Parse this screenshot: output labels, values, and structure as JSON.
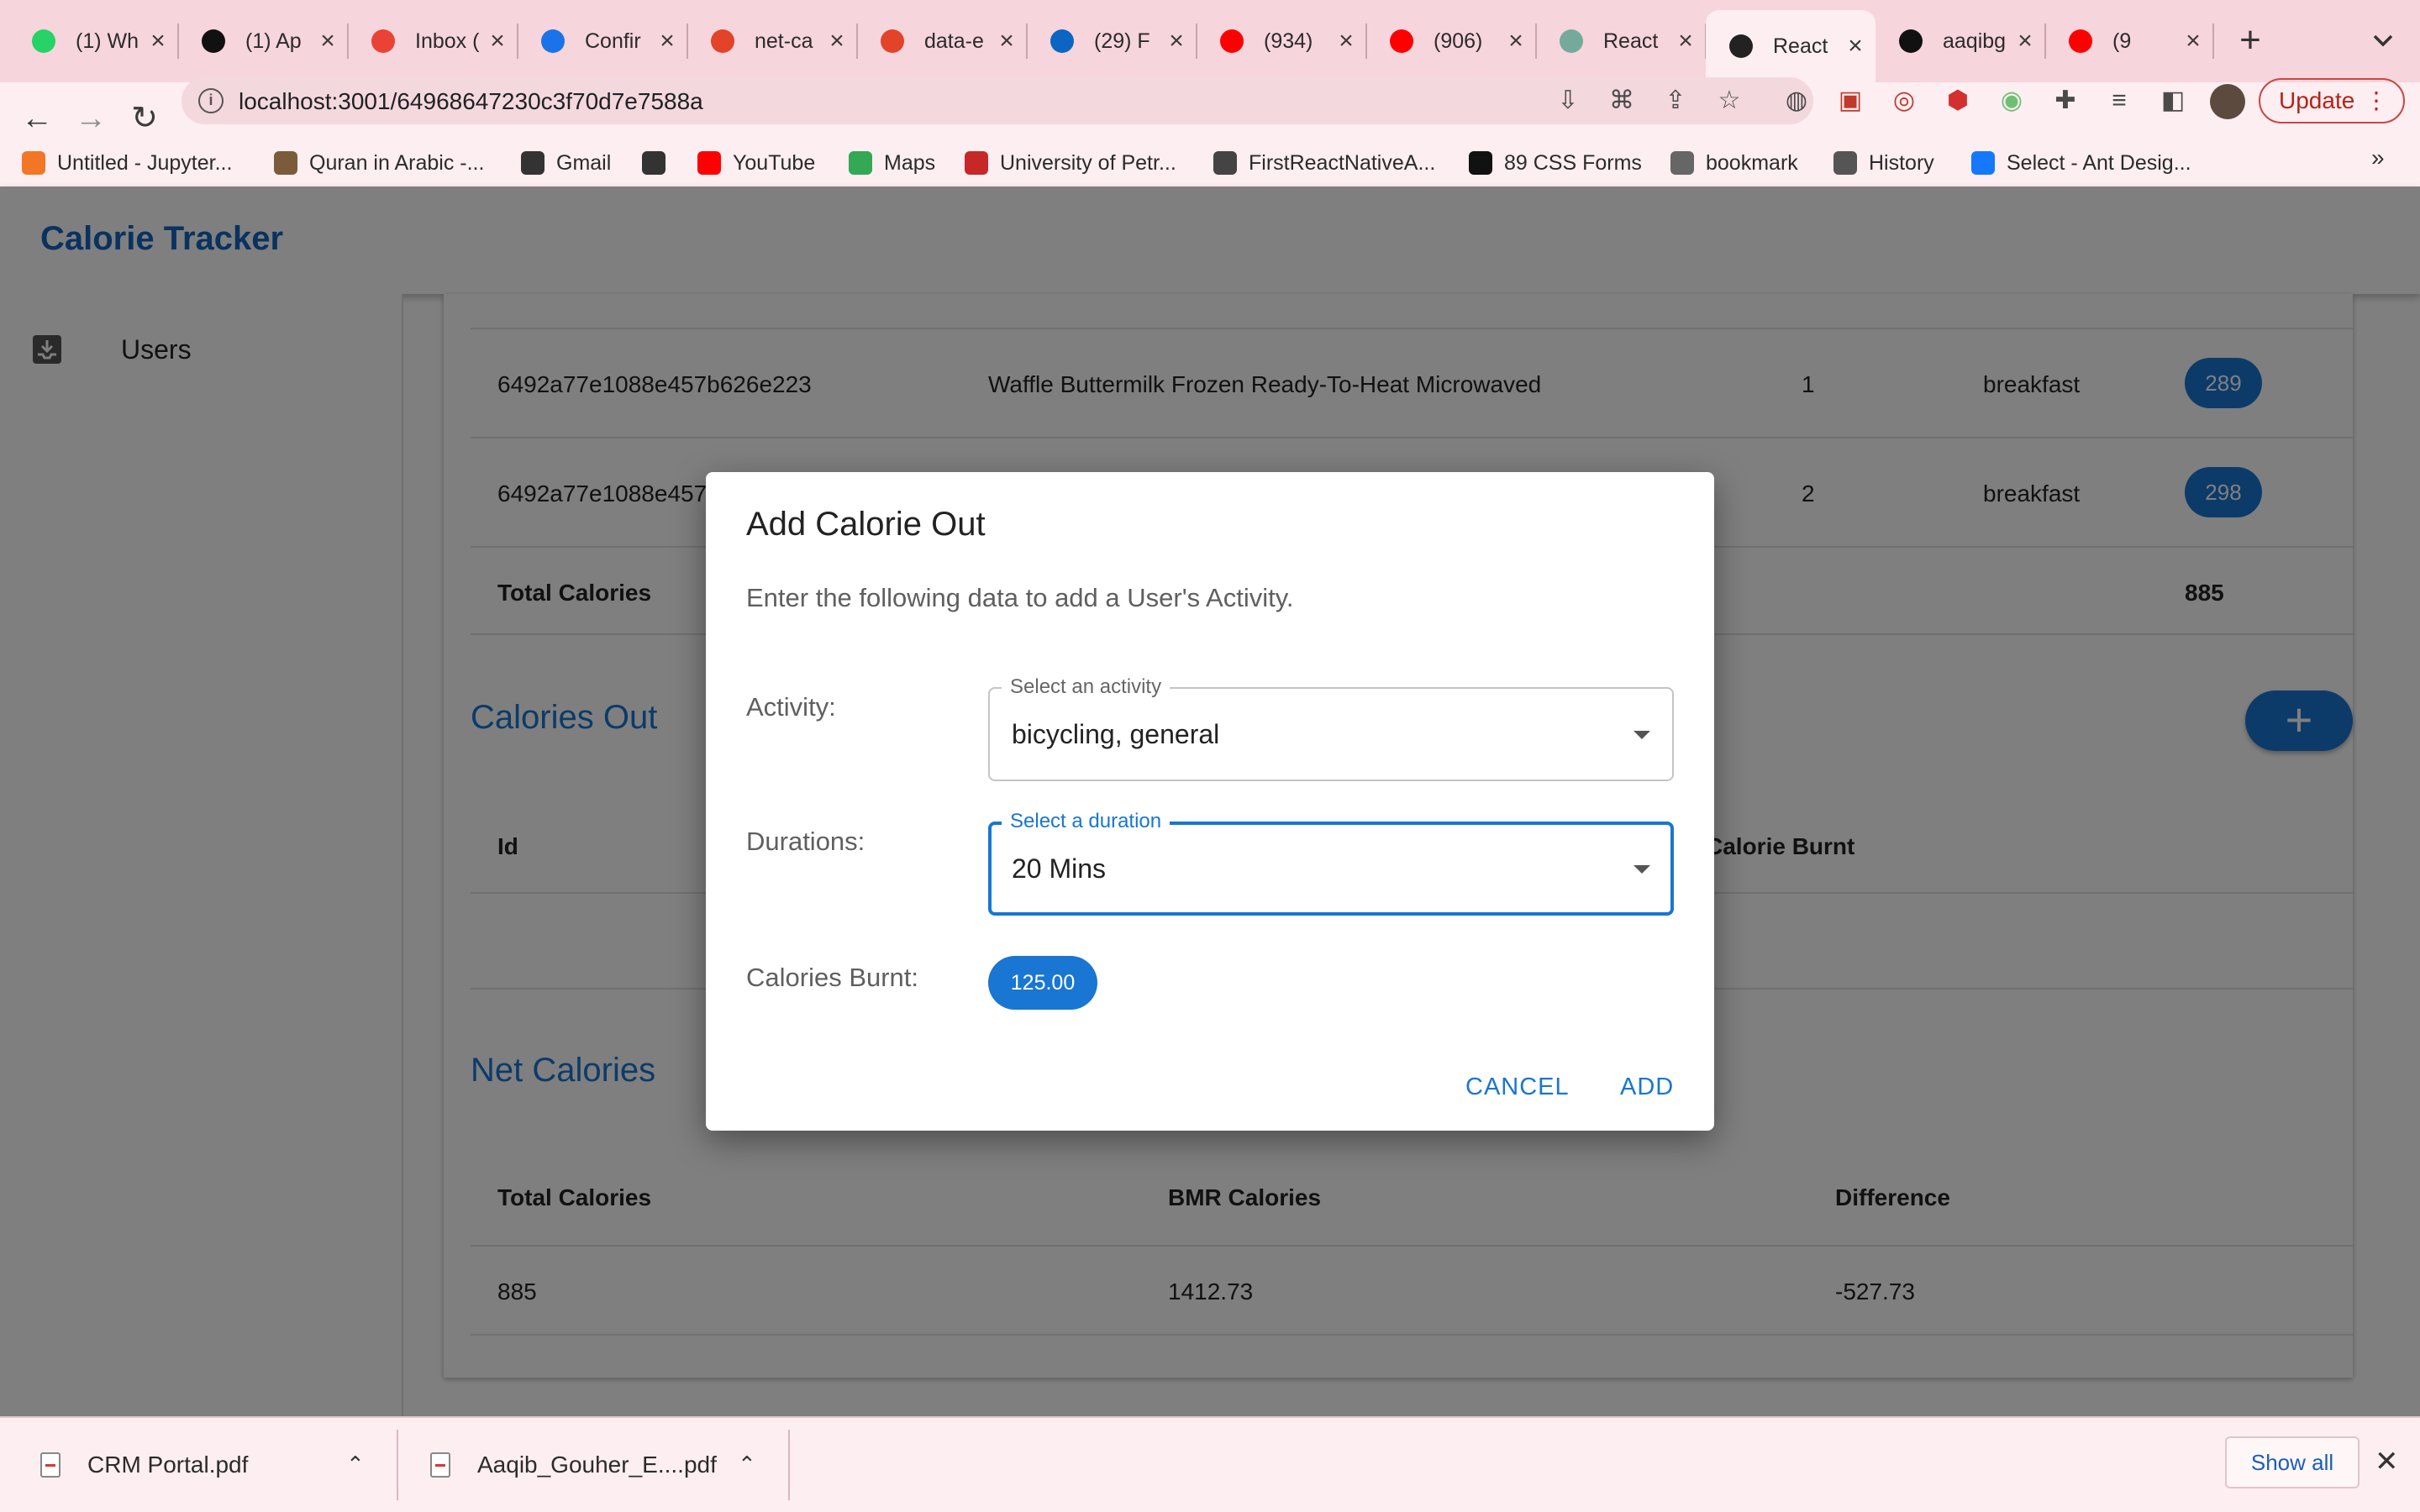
{
  "browser": {
    "tabs": [
      {
        "title": "(1) Wh",
        "icon": "whatsapp-icon",
        "color": "#25d366"
      },
      {
        "title": "(1) Ap",
        "icon": "circle-7-icon",
        "color": "#111111"
      },
      {
        "title": "Inbox (",
        "icon": "gmail-icon",
        "color": "#ea4335"
      },
      {
        "title": "Confir",
        "icon": "c-logo-icon",
        "color": "#1a73e8"
      },
      {
        "title": "net-ca",
        "icon": "gitlab-icon",
        "color": "#e24329"
      },
      {
        "title": "data-e",
        "icon": "gitlab-icon",
        "color": "#e24329"
      },
      {
        "title": "(29) F",
        "icon": "linkedin-icon",
        "color": "#0a66c2"
      },
      {
        "title": "(934) ",
        "icon": "youtube-icon",
        "color": "#ff0000"
      },
      {
        "title": "(906) ",
        "icon": "youtube-icon",
        "color": "#ff0000"
      },
      {
        "title": "React",
        "icon": "openai-icon",
        "color": "#74aa9c"
      },
      {
        "title": "React",
        "icon": "react-icon",
        "color": "#222222",
        "active": true
      },
      {
        "title": "aaqibg",
        "icon": "github-icon",
        "color": "#111111"
      },
      {
        "title": "(9",
        "icon": "youtube-icon",
        "color": "#ff0000"
      }
    ],
    "url": "localhost:3001/64968647230c3f70d7e7588a",
    "update_label": "Update",
    "bookmarks": [
      {
        "label": "Untitled - Jupyter...",
        "icon": "jupyter-icon"
      },
      {
        "label": "Quran in Arabic -...",
        "icon": "quran-icon"
      },
      {
        "label": "Gmail",
        "icon": "globe-icon"
      },
      {
        "label": "",
        "icon": "globe-icon"
      },
      {
        "label": "YouTube",
        "icon": "youtube-icon"
      },
      {
        "label": "Maps",
        "icon": "maps-icon"
      },
      {
        "label": "University of Petr...",
        "icon": "university-icon"
      },
      {
        "label": "FirstReactNativeA...",
        "icon": "react-native-icon"
      },
      {
        "label": "89 CSS Forms",
        "icon": "f-logo-icon"
      },
      {
        "label": "bookmark",
        "icon": "folder-icon"
      },
      {
        "label": "History",
        "icon": "history-icon"
      },
      {
        "label": "Select - Ant Desig...",
        "icon": "ant-design-icon"
      }
    ],
    "more_bookmarks": "»"
  },
  "app": {
    "title": "Calorie Tracker",
    "nav_users": "Users"
  },
  "calorie_in": {
    "rows": [
      {
        "id": "6492a77e1088e457b626e223",
        "food": "Waffle Buttermilk Frozen Ready-To-Heat Microwaved",
        "qty": "1",
        "meal": "breakfast",
        "calories": "289"
      },
      {
        "id": "6492a77e1088e457",
        "food": "",
        "qty": "2",
        "meal": "breakfast",
        "calories": "298"
      }
    ],
    "total_label": "Total Calories",
    "total_value": "885"
  },
  "calories_out": {
    "title": "Calories Out",
    "col_id": "Id",
    "col_burnt": "Calorie Burnt",
    "add_label": "+"
  },
  "net_calories": {
    "title": "Net Calories",
    "headers": [
      "Total Calories",
      "BMR Calories",
      "Difference"
    ],
    "values": [
      "885",
      "1412.73",
      "-527.73"
    ]
  },
  "dialog": {
    "title": "Add Calorie Out",
    "text": "Enter the following data to add a User's Activity.",
    "activity_label": "Activity:",
    "activity_legend": "Select an activity",
    "activity_value": "bicycling, general",
    "duration_label": "Durations:",
    "duration_legend": "Select a duration",
    "duration_value": "20 Mins",
    "burnt_label": "Calories Burnt:",
    "burnt_value": "125.00",
    "cancel": "CANCEL",
    "add": "ADD"
  },
  "downloads": {
    "items": [
      "CRM Portal.pdf",
      "Aaqib_Gouher_E....pdf"
    ],
    "show_all": "Show all"
  },
  "colors": {
    "accent": "#1976d2",
    "chrome": "#f7d5dc",
    "brand": "#1565c0"
  }
}
